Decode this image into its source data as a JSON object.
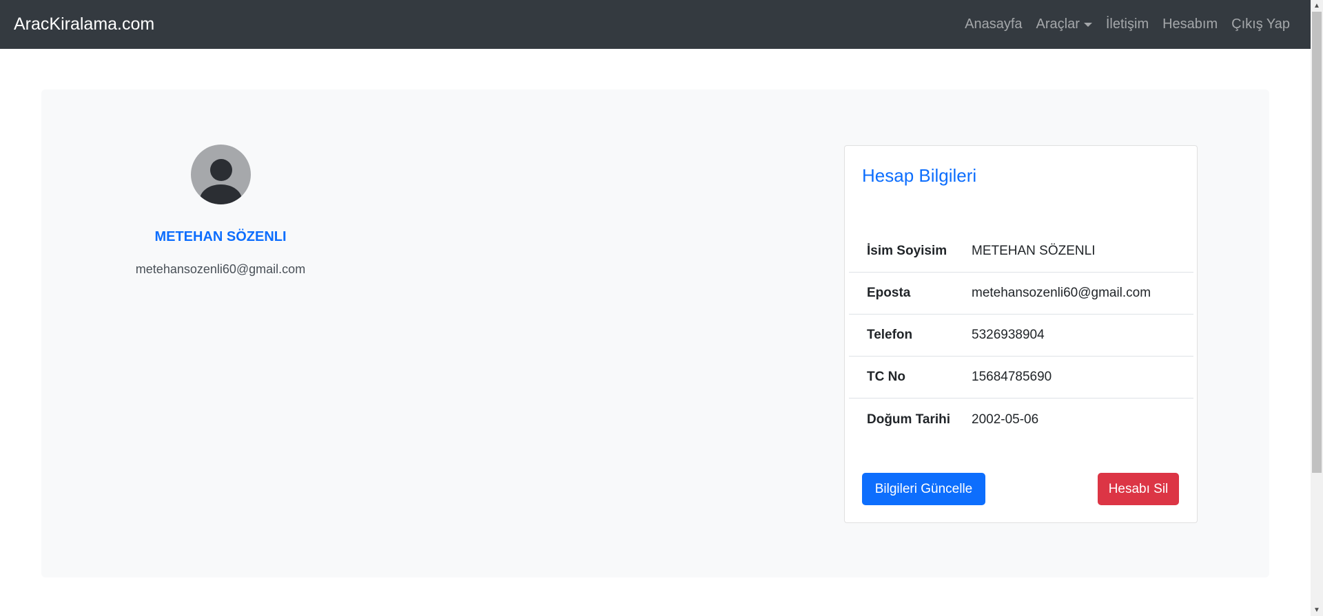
{
  "navbar": {
    "brand": "AracKiralama.com",
    "links": [
      {
        "label": "Anasayfa"
      },
      {
        "label": "Araçlar"
      },
      {
        "label": "İletişim"
      },
      {
        "label": "Hesabım"
      },
      {
        "label": "Çıkış Yap"
      }
    ]
  },
  "profile": {
    "name": "METEHAN SÖZENLI",
    "email": "metehansozenli60@gmail.com",
    "avatar_icon": "user-avatar-icon"
  },
  "account": {
    "title": "Hesap Bilgileri",
    "rows": [
      {
        "label": "İsim Soyisim",
        "value": "METEHAN SÖZENLI"
      },
      {
        "label": "Eposta",
        "value": "metehansozenli60@gmail.com"
      },
      {
        "label": "Telefon",
        "value": "5326938904"
      },
      {
        "label": "TC No",
        "value": "15684785690"
      },
      {
        "label": "Doğum Tarihi",
        "value": "2002-05-06"
      }
    ],
    "update_button": "Bilgileri Güncelle",
    "delete_button": "Hesabı Sil"
  },
  "colors": {
    "navbar_bg": "#343a40",
    "primary": "#0d6efd",
    "danger": "#dc3545",
    "panel_bg": "#f8f9fa"
  }
}
